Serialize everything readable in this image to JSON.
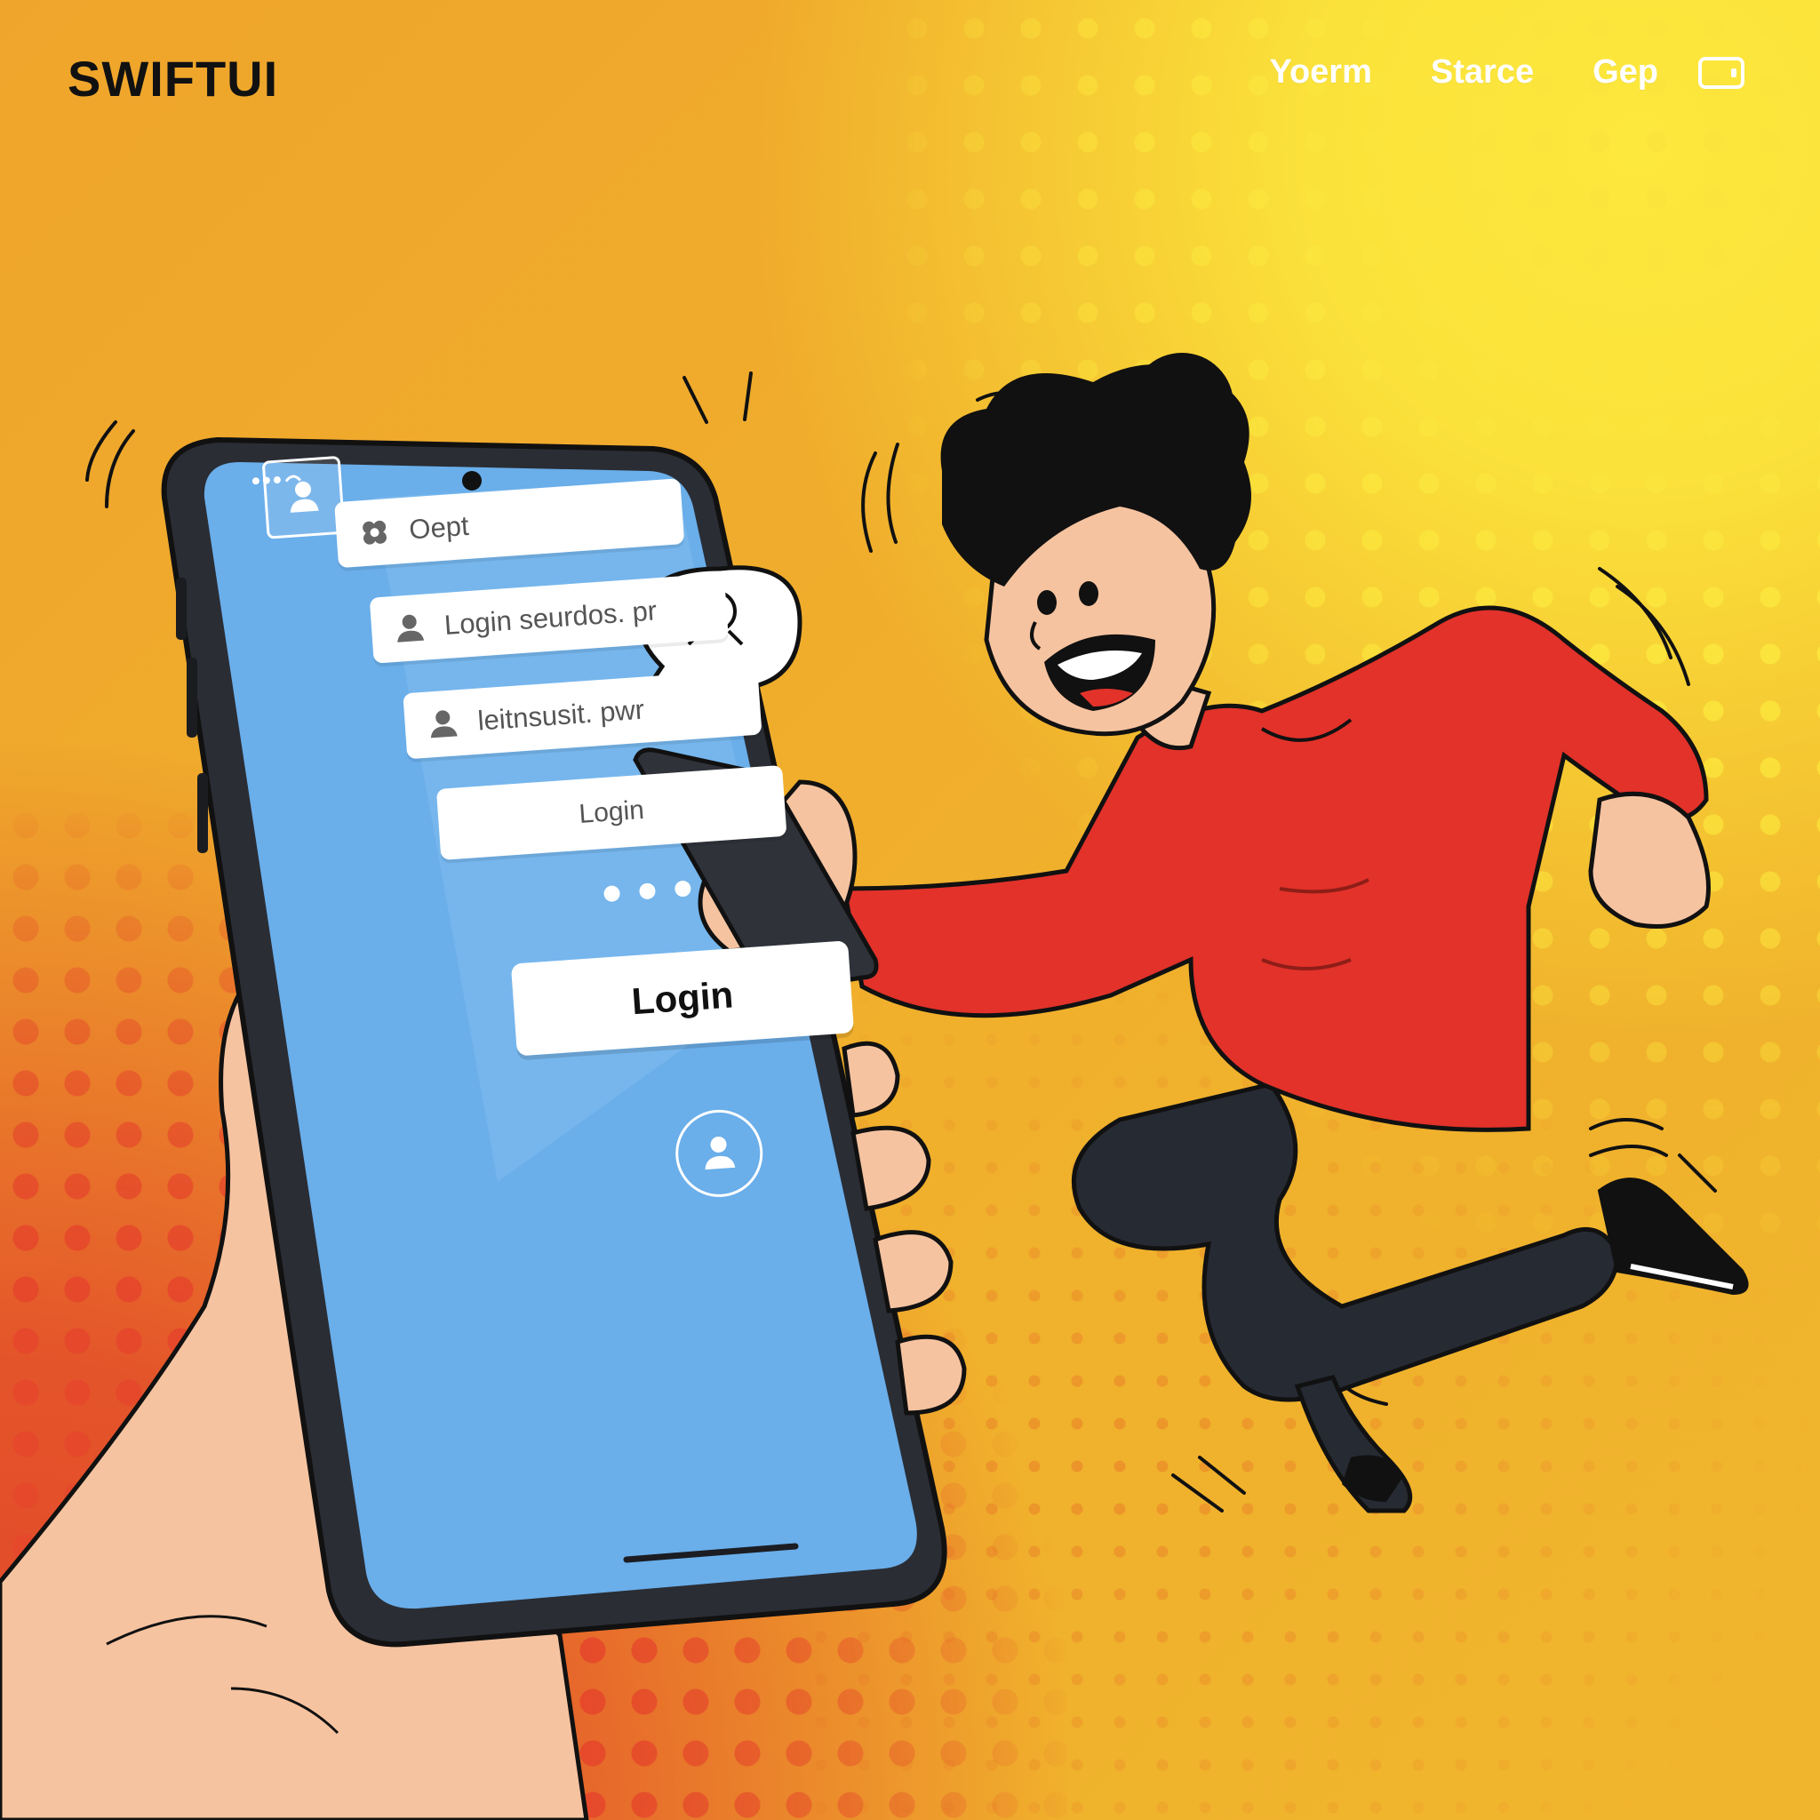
{
  "brand": {
    "title": "SWIFTUI"
  },
  "nav": {
    "links": [
      "Yoerm",
      "Starce",
      "Gep"
    ],
    "icon": "window-icon"
  },
  "phone": {
    "fields": [
      {
        "icon": "grid-icon",
        "text": "Oept"
      },
      {
        "icon": "user-icon",
        "text": "Login seurdos. pr"
      },
      {
        "icon": "user-icon",
        "text": "leitnsusit. pwr"
      }
    ],
    "secondary_button": "Login",
    "primary_button": "Login",
    "profile_icon": "user-circle-icon",
    "status_icons": [
      "signal-icon",
      "wifi-icon",
      "battery-icon"
    ]
  },
  "speech_bubble": {
    "icon": "magnifier-face-icon"
  },
  "colors": {
    "background": "#efa92a",
    "yellow_dots": "#fbe43c",
    "red_dots": "#e5482b",
    "screen": "#6aaeea",
    "sweater": "#e2322a",
    "pants": "#262a33",
    "skin": "#f6c3a0"
  }
}
